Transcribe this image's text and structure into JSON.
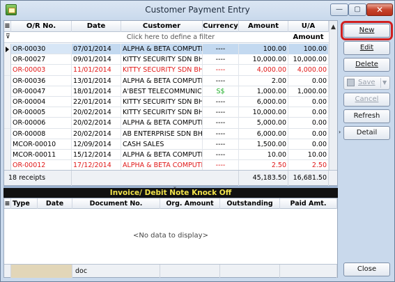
{
  "window": {
    "title": "Customer Payment Entry",
    "min_glyph": "—",
    "max_glyph": "▢",
    "close_glyph": "✕"
  },
  "grid": {
    "columns": [
      "O/R No.",
      "Date",
      "Customer",
      "Currency",
      "Amount",
      "U/A Amount"
    ],
    "filter_hint": "Click here to define a filter",
    "rows": [
      {
        "no": "OR-00030",
        "date": "07/01/2014",
        "customer": "ALPHA & BETA COMPUTER",
        "currency": "----",
        "amount": "100.00",
        "ua": "100.00",
        "style": "selected"
      },
      {
        "no": "OR-00027",
        "date": "09/01/2014",
        "customer": "KITTY SECURITY SDN BHD",
        "currency": "----",
        "amount": "10,000.00",
        "ua": "10,000.00",
        "style": ""
      },
      {
        "no": "OR-00003",
        "date": "11/01/2014",
        "customer": "KITTY SECURITY SDN BHD",
        "currency": "----",
        "amount": "4,000.00",
        "ua": "4,000.00",
        "style": "red"
      },
      {
        "no": "OR-00036",
        "date": "13/01/2014",
        "customer": "ALPHA & BETA COMPUTER",
        "currency": "----",
        "amount": "2.00",
        "ua": "0.00",
        "style": ""
      },
      {
        "no": "OR-00047",
        "date": "18/01/2014",
        "customer": "A'BEST TELECOMMUNIC...",
        "currency": "S$",
        "amount": "1,000.00",
        "ua": "1,000.00",
        "style": "green-currency"
      },
      {
        "no": "OR-00004",
        "date": "22/01/2014",
        "customer": "KITTY SECURITY SDN BHD",
        "currency": "----",
        "amount": "6,000.00",
        "ua": "0.00",
        "style": ""
      },
      {
        "no": "OR-00005",
        "date": "20/02/2014",
        "customer": "KITTY SECURITY SDN BHD",
        "currency": "----",
        "amount": "10,000.00",
        "ua": "0.00",
        "style": ""
      },
      {
        "no": "OR-00006",
        "date": "20/02/2014",
        "customer": "ALPHA & BETA COMPUTER",
        "currency": "----",
        "amount": "5,000.00",
        "ua": "0.00",
        "style": ""
      },
      {
        "no": "OR-00008",
        "date": "20/02/2014",
        "customer": "AB ENTERPRISE SDN BHD",
        "currency": "----",
        "amount": "6,000.00",
        "ua": "0.00",
        "style": ""
      },
      {
        "no": "MCOR-00010",
        "date": "12/09/2014",
        "customer": "CASH SALES",
        "currency": "----",
        "amount": "1,500.00",
        "ua": "0.00",
        "style": ""
      },
      {
        "no": "MCOR-00011",
        "date": "15/12/2014",
        "customer": "ALPHA & BETA COMPUTER",
        "currency": "----",
        "amount": "10.00",
        "ua": "10.00",
        "style": ""
      },
      {
        "no": "OR-00012",
        "date": "17/12/2014",
        "customer": "ALPHA & BETA COMPUTER",
        "currency": "----",
        "amount": "2.50",
        "ua": "2.50",
        "style": "red"
      }
    ],
    "footer": {
      "count": "18 receipts",
      "amount_total": "45,183.50",
      "ua_total": "16,681.50"
    }
  },
  "knock_off": {
    "title": "Invoice/ Debit Note Knock Off",
    "columns": [
      "Type",
      "Date",
      "Document No.",
      "Org. Amount",
      "Outstanding",
      "Paid Amt."
    ],
    "empty_text": "<No data to display>",
    "footer_doc": "doc"
  },
  "buttons": {
    "new": "New",
    "edit": "Edit",
    "delete": "Delete",
    "save": "Save",
    "cancel": "Cancel",
    "refresh": "Refresh",
    "detail": "Detail",
    "close": "Close"
  },
  "colors": {
    "red_text": "#e01818",
    "currency_green": "#21b02a",
    "knock_off_title": "#f2e34a",
    "highlight": "#d02020"
  }
}
